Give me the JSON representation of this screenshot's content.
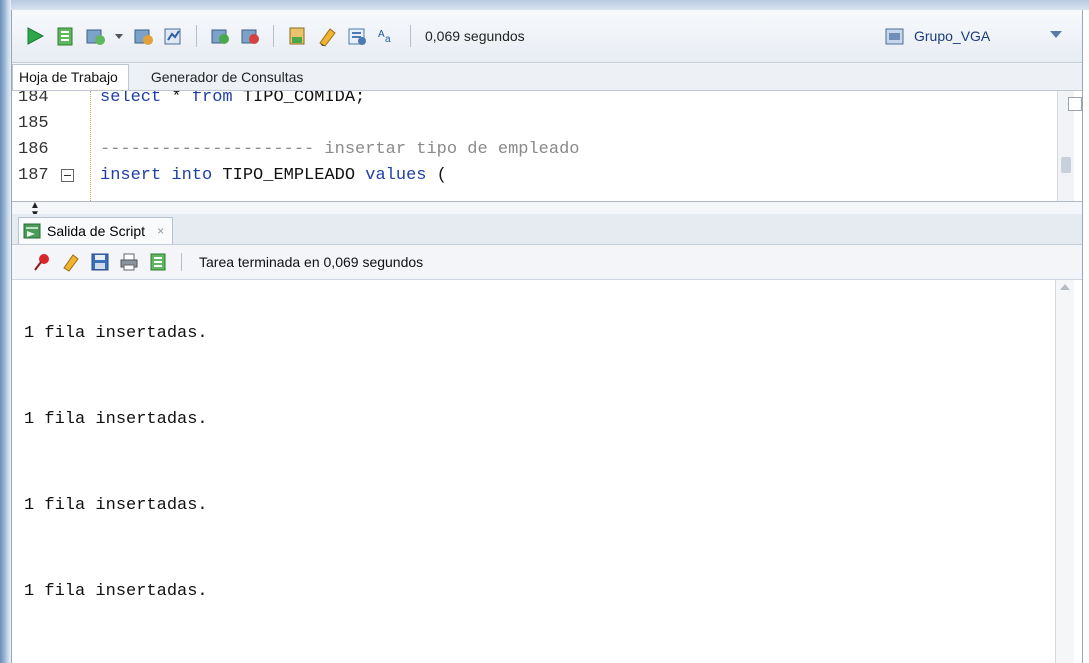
{
  "toolbar": {
    "icons": [
      "run-statement-icon",
      "run-script-icon",
      "commit-icon",
      "dropdown-icon",
      "rollback-icon",
      "autotrace-icon",
      "explain-plan-icon",
      "tuning-icon",
      "sql-history-icon",
      "clear-icon",
      "unshared-sql-icon",
      "format-icon"
    ],
    "elapsed": "0,069 segundos",
    "connection": "Grupo_VGA"
  },
  "editor_tabs": [
    {
      "label": "Hoja de Trabajo",
      "active": true
    },
    {
      "label": "Generador de Consultas",
      "active": false
    }
  ],
  "editor": {
    "lines": [
      {
        "num": "184",
        "tokens": [
          {
            "t": "select",
            "c": "kw"
          },
          {
            "t": " * ",
            "c": "id"
          },
          {
            "t": "from",
            "c": "kw"
          },
          {
            "t": " TIPO_COMIDA;",
            "c": "id"
          }
        ]
      },
      {
        "num": "185",
        "tokens": []
      },
      {
        "num": "186",
        "tokens": [
          {
            "t": "--------------------- insertar tipo de empleado",
            "c": "cm"
          }
        ]
      },
      {
        "num": "187",
        "tokens": [
          {
            "t": "insert",
            "c": "kw"
          },
          {
            "t": " ",
            "c": "id"
          },
          {
            "t": "into",
            "c": "kw"
          },
          {
            "t": " TIPO_EMPLEADO ",
            "c": "id"
          },
          {
            "t": "values",
            "c": "kw"
          },
          {
            "t": " (",
            "c": "id"
          }
        ]
      }
    ]
  },
  "output_panel": {
    "tab_label": "Salida de Script",
    "tab_close": "×",
    "status": "Tarea terminada en 0,069 segundos",
    "toolbar_icons": [
      "pin-icon",
      "clear-output-icon",
      "save-icon",
      "print-icon",
      "open-file-icon"
    ]
  },
  "output": {
    "lines": [
      "1 fila insertadas.",
      "1 fila insertadas.",
      "1 fila insertadas.",
      "1 fila insertadas."
    ]
  },
  "colors": {
    "keyword": "#1f3fa7",
    "comment": "#8a8a8a",
    "accent": "#1a3c7a"
  }
}
